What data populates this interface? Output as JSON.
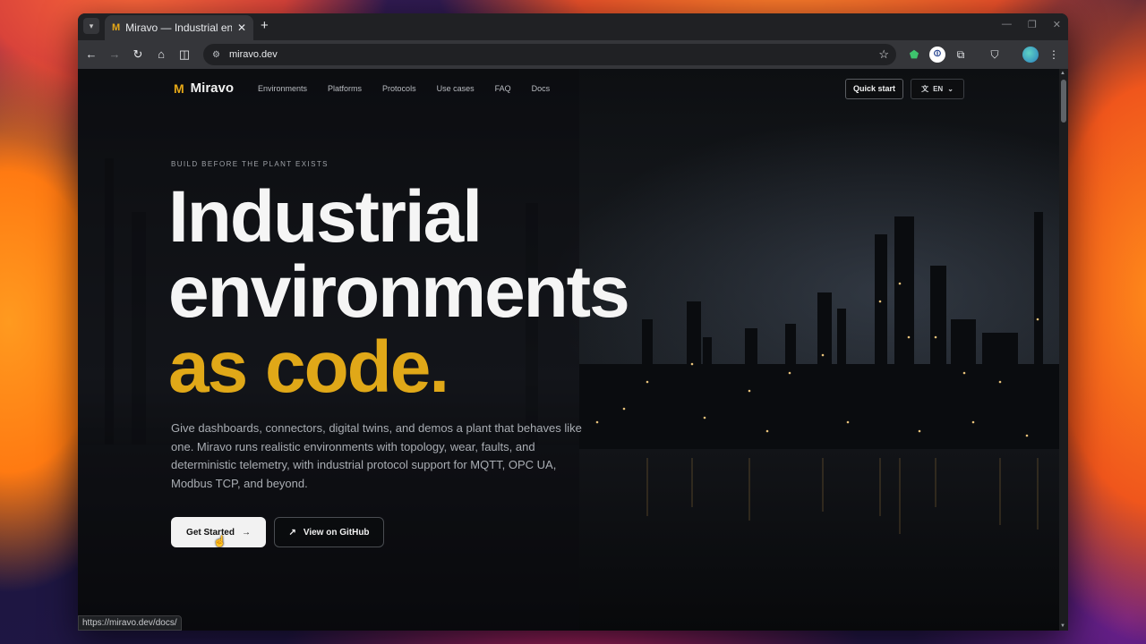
{
  "browser": {
    "tab_title": "Miravo — Industrial envi",
    "tab_favicon": "M",
    "url": "miravo.dev",
    "status_url": "https://miravo.dev/docs/",
    "icons": {
      "tab_menu": "chevron-down-icon",
      "close": "close-icon",
      "new_tab": "plus-icon",
      "back": "arrow-left-icon",
      "forward": "arrow-right-icon",
      "reload": "reload-icon",
      "home": "home-icon",
      "split": "split-view-icon",
      "bookmark": "star-icon",
      "shield": "shield-extension-icon",
      "profile": "profile-extension-icon",
      "extensions": "puzzle-icon",
      "incognito": "spy-icon",
      "avatar": "avatar-icon",
      "menu": "kebab-menu-icon"
    }
  },
  "site": {
    "brand": "Miravo",
    "nav": [
      "Environments",
      "Platforms",
      "Protocols",
      "Use cases",
      "FAQ",
      "Docs"
    ],
    "quick_start": "Quick start",
    "language": "EN",
    "eyebrow": "BUILD BEFORE THE PLANT EXISTS",
    "headline_line1": "Industrial",
    "headline_line2": "environments",
    "headline_accent": "as code.",
    "lede": "Give dashboards, connectors, digital twins, and demos a plant that behaves like one. Miravo runs realistic environments with topology, wear, faults, and deterministic telemetry, with industrial protocol support for MQTT, OPC UA, Modbus TCP, and beyond.",
    "cta_primary": "Get Started",
    "cta_secondary": "View on GitHub"
  },
  "colors": {
    "accent": "#e0a818",
    "page_bg": "#0d0f12"
  }
}
